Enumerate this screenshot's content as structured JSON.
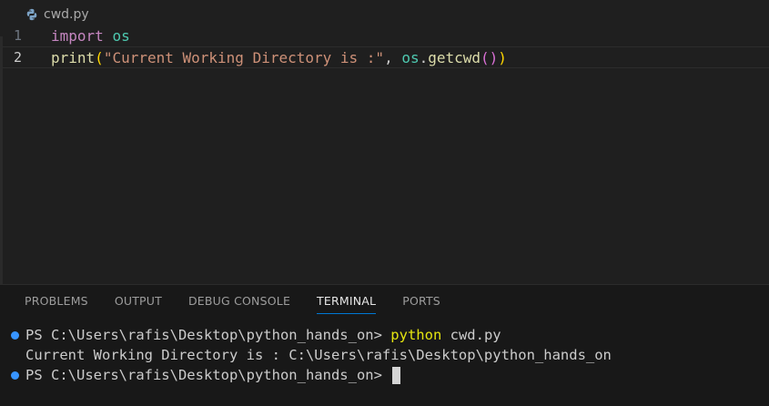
{
  "editor": {
    "tab_filename": "cwd.py",
    "file_icon": "python-icon",
    "lines": [
      {
        "number": "1",
        "tokens": {
          "t0": "import",
          "t1": " ",
          "t2": "os"
        }
      },
      {
        "number": "2",
        "tokens": {
          "t0": "print",
          "t1": "(",
          "t2": "\"Current Working Directory is :\"",
          "t3": ", ",
          "t4": "os",
          "t5": ".",
          "t6": "getcwd",
          "t7": "()",
          "t8": ")"
        }
      }
    ]
  },
  "panel": {
    "tabs": [
      "PROBLEMS",
      "OUTPUT",
      "DEBUG CONSOLE",
      "TERMINAL",
      "PORTS"
    ],
    "active_tab": "TERMINAL",
    "terminal": {
      "line1_prompt": "PS C:\\Users\\rafis\\Desktop\\python_hands_on> ",
      "line1_cmd": "python",
      "line1_args": " cwd.py",
      "line2_output": "Current Working Directory is : C:\\Users\\rafis\\Desktop\\python_hands_on",
      "line3_prompt": "PS C:\\Users\\rafis\\Desktop\\python_hands_on> "
    }
  },
  "colors": {
    "keyword": "#c586c0",
    "module": "#4ec9b0",
    "function": "#dcdcaa",
    "string": "#ce9178",
    "variable": "#4fc1ff",
    "bracket_level1": "#ffd700",
    "bracket_level2": "#da70d6",
    "terminal_command": "#e5e510",
    "decoration_dot": "#3794ff",
    "active_tab_underline": "#0078d4"
  }
}
